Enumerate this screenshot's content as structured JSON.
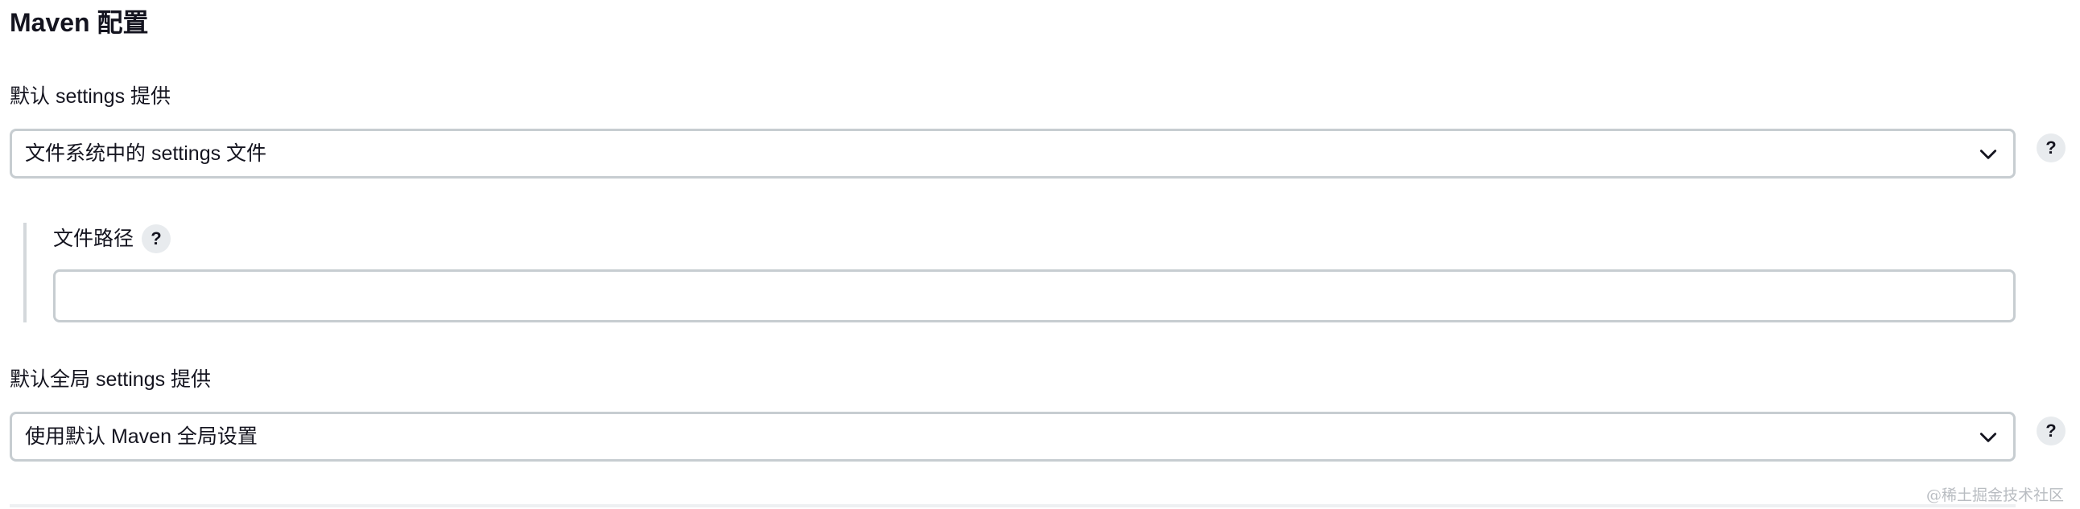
{
  "section": {
    "title": "Maven 配置"
  },
  "settings_provider": {
    "label": "默认 settings 提供",
    "selected": "文件系统中的 settings 文件",
    "help": "?"
  },
  "file_path": {
    "label": "文件路径",
    "value": "",
    "help": "?"
  },
  "global_settings_provider": {
    "label": "默认全局 settings 提供",
    "selected": "使用默认 Maven 全局设置",
    "help": "?"
  },
  "watermark": {
    "text": "@稀土掘金技术社区"
  },
  "icons": {
    "dropdown": "chevron-down-icon",
    "help": "help-icon"
  },
  "colors": {
    "border": "#c7cdd1",
    "help_bg": "#e8ebee",
    "text": "#14141f",
    "nested_bar": "#d4d8db"
  }
}
